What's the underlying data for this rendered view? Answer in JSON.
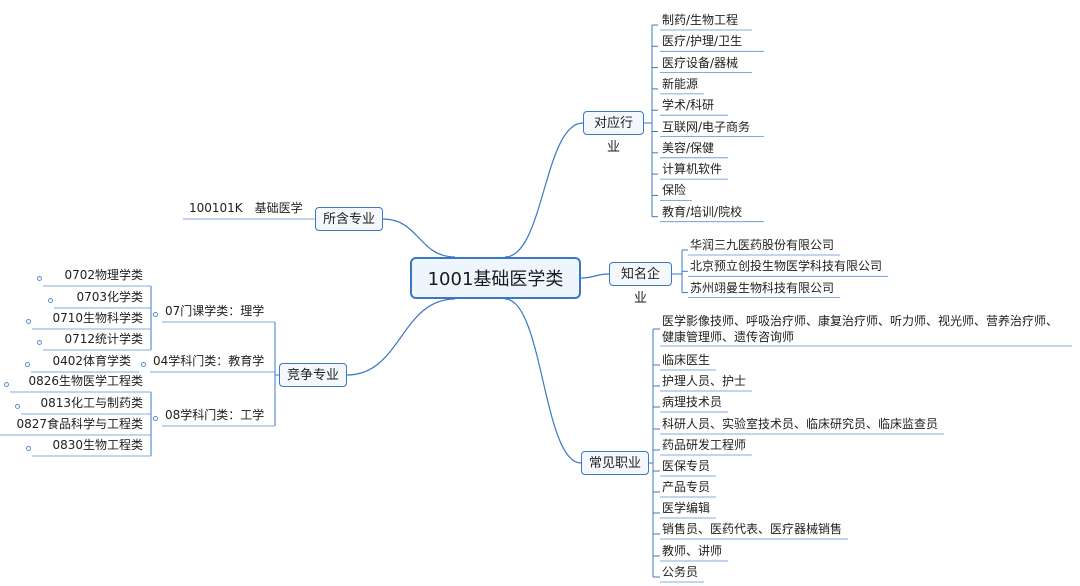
{
  "central": "1001基础医学类",
  "branches": {
    "industry": {
      "label": "对应行业",
      "items": [
        "制药/生物工程",
        "医疗/护理/卫生",
        "医疗设备/器械",
        "新能源",
        "学术/科研",
        "互联网/电子商务",
        "美容/保健",
        "计算机软件",
        "保险",
        "教育/培训/院校"
      ]
    },
    "companies": {
      "label": "知名企业",
      "items": [
        "华润三九医药股份有限公司",
        "北京预立创投生物医学科技有限公司",
        "苏州翊曼生物科技有限公司"
      ]
    },
    "majors": {
      "label": "所含专业",
      "items": [
        "100101K　基础医学"
      ]
    },
    "competing": {
      "label": "竞争专业",
      "groups": [
        {
          "label": "07门课学类：理学",
          "items": [
            "0702物理学类",
            "0703化学类",
            "0710生物科学类",
            "0712统计学类"
          ]
        },
        {
          "label": "04学科门类：教育学",
          "items": [
            "0402体育学类"
          ]
        },
        {
          "label": "08学科门类：工学",
          "items": [
            "0826生物医学工程类",
            "0813化工与制药类",
            "0827食品科学与工程类",
            "0830生物工程类"
          ]
        }
      ]
    },
    "careers": {
      "label": "常见职业",
      "items": [
        "医学影像技师、呼吸治疗师、康复治疗师、听力师、视光师、营养治疗师、\n健康管理师、遗传咨询师",
        "临床医生",
        "护理人员、护士",
        "病理技术员",
        "科研人员、实验室技术员、临床研究员、临床监查员",
        "药品研发工程师",
        "医保专员",
        "产品专员",
        "医学编辑",
        "销售员、医药代表、医疗器械销售",
        "教师、讲师",
        "公务员"
      ]
    }
  },
  "colors": {
    "line": "#3a78c3",
    "leaf_line": "#5a8fd0"
  }
}
